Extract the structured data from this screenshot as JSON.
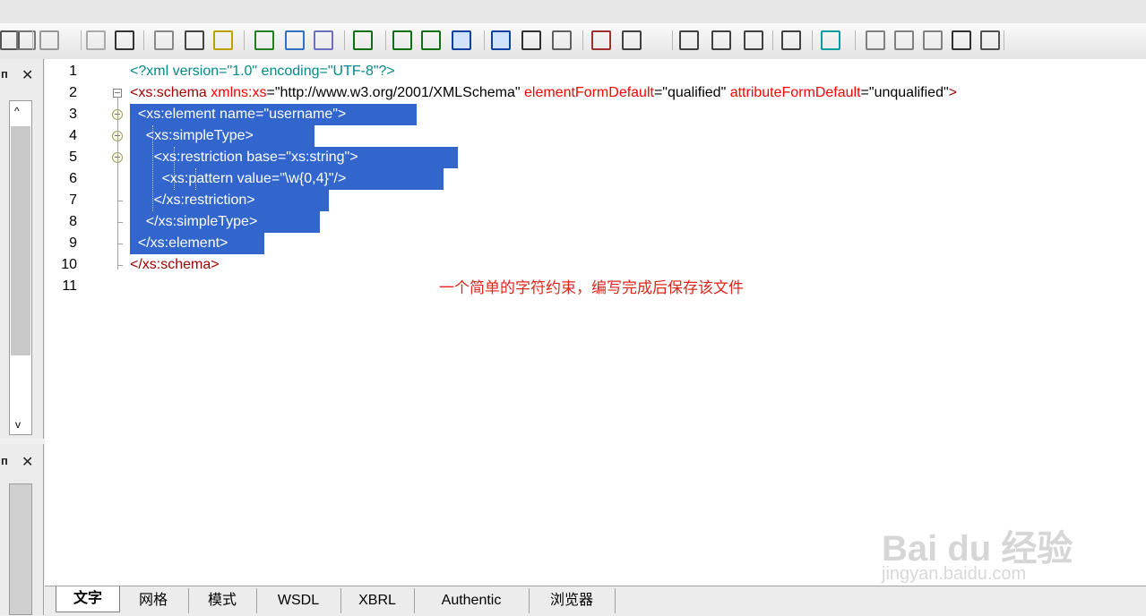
{
  "editor": {
    "line_numbers": [
      "1",
      "2",
      "3",
      "4",
      "5",
      "6",
      "7",
      "8",
      "9",
      "10",
      "11"
    ],
    "lines": [
      {
        "tokens": [
          {
            "t": "<?xml version=\"1.0\" encoding=\"UTF-8\"?>",
            "c": "decl"
          }
        ]
      },
      {
        "tokens": [
          {
            "t": "<xs:schema ",
            "c": "tag"
          },
          {
            "t": "xmlns:xs",
            "c": "attr"
          },
          {
            "t": "=",
            "c": "eq"
          },
          {
            "t": "\"http://www.w3.org/2001/XMLSchema\"",
            "c": "val"
          },
          {
            "t": " elementFormDefault",
            "c": "attr"
          },
          {
            "t": "=",
            "c": "eq"
          },
          {
            "t": "\"qualified\"",
            "c": "val"
          },
          {
            "t": " attributeFormDefault",
            "c": "attr"
          },
          {
            "t": "=",
            "c": "eq"
          },
          {
            "t": "\"unqualified\"",
            "c": "val"
          },
          {
            "t": ">",
            "c": "tag"
          }
        ]
      },
      {
        "tokens": [
          {
            "t": "  <xs:element name=\"username\">",
            "c": "sel"
          }
        ]
      },
      {
        "tokens": [
          {
            "t": "    <xs:simpleType>",
            "c": "sel"
          }
        ]
      },
      {
        "tokens": [
          {
            "t": "      <xs:restriction base=\"xs:string\">",
            "c": "sel"
          }
        ]
      },
      {
        "tokens": [
          {
            "t": "        <xs:pattern value=\"\\w{0,4}\"/>",
            "c": "sel"
          }
        ]
      },
      {
        "tokens": [
          {
            "t": "      </xs:restriction>",
            "c": "sel"
          }
        ]
      },
      {
        "tokens": [
          {
            "t": "    </xs:simpleType>",
            "c": "sel"
          }
        ]
      },
      {
        "tokens": [
          {
            "t": "  </xs:element>",
            "c": "sel"
          }
        ]
      },
      {
        "tokens": [
          {
            "t": "</xs:schema>",
            "c": "tag"
          }
        ]
      },
      {
        "tokens": []
      }
    ],
    "annotation": "一个简单的字符约束，编写完成后保存该文件"
  },
  "tabs": [
    "文字",
    "网格",
    "模式",
    "WSDL",
    "XBRL",
    "Authentic",
    "浏览器"
  ],
  "active_tab": "文字",
  "toolbar_icons": [
    "paste-icon",
    "clipboard-icon",
    "undo-icon",
    "redo-icon",
    "find-icon",
    "find-next-icon",
    "replace-icon",
    "check-wellformed-icon",
    "validate-icon",
    "schema-icon",
    "spellcheck-icon",
    "xsl-transform-icon",
    "xsl-fo-icon",
    "xquery-icon",
    "text-view-icon",
    "grid-view-icon",
    "db-icon",
    "schema-def-icon",
    "file-icon",
    "word-wrap-icon",
    "pretty-print-icon",
    "indent-icon",
    "collapse-icon",
    "toggle-icon",
    "bookmark-icon",
    "bookmark-next-icon",
    "bookmark-prev-icon",
    "bookmark-clear-icon",
    "comment-icon",
    "settings-icon"
  ],
  "watermark": {
    "brand": "Bai du 经验",
    "url": "jingyan.baidu.com"
  },
  "colors": {
    "selection": "#3366cc",
    "attr": "#ff0000",
    "tag": "#a00000",
    "decl": "#008a8a",
    "annotation": "#e0251b"
  }
}
